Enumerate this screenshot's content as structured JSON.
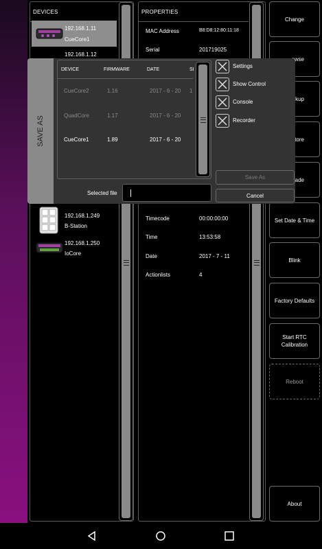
{
  "devices_panel": {
    "title": "DEVICES",
    "items": [
      {
        "ip": "192.168.1.11",
        "name": "CueCore1",
        "icon": "cuecore-icon",
        "selected": true
      },
      {
        "ip": "192.168.1.12",
        "name": "",
        "icon": "cuecore-icon",
        "selected": false
      },
      {
        "ip": "192.168.1.249",
        "name": "B-Station",
        "icon": "bstation-icon",
        "selected": false
      },
      {
        "ip": "192.168.1.250",
        "name": "IoCore",
        "icon": "iocore-icon",
        "selected": false
      }
    ]
  },
  "properties_panel": {
    "title": "PROPERTIES",
    "rows": [
      {
        "label": "MAC Address",
        "value": "B8:D8:12:80:11:18"
      },
      {
        "label": "Serial",
        "value": "201719025"
      },
      {
        "label": "Timecode",
        "value": "00:00:00:00"
      },
      {
        "label": "Time",
        "value": "13:53:58"
      },
      {
        "label": "Date",
        "value": "2017 - 7 - 11"
      },
      {
        "label": "Actionlists",
        "value": "4"
      }
    ]
  },
  "right_buttons": {
    "change": "Change",
    "browse": "owse",
    "backup": "ckup",
    "restore": "store",
    "upgrade": "rade",
    "set_date_time": "Set Date & Time",
    "blink": "Blink",
    "factory_defaults": "Factory Defaults",
    "start_rtc_calibration": "Start RTC Calibration",
    "reboot": "Reboot",
    "about": "About"
  },
  "save_as_dialog": {
    "tab_label": "SAVE AS",
    "columns": {
      "device": "DEVICE",
      "firmware": "FIRMWARE",
      "date": "DATE",
      "size": "SI"
    },
    "rows": [
      {
        "device": "CueCore2",
        "firmware": "1.16",
        "date": "2017 - 6 - 20",
        "size": "1",
        "dimmed": true
      },
      {
        "device": "QuadCore",
        "firmware": "1.17",
        "date": "2017 - 6 - 20",
        "size": "",
        "dimmed": true
      },
      {
        "device": "CueCore1",
        "firmware": "1.89",
        "date": "2017 - 6 - 20",
        "size": "",
        "dimmed": false
      }
    ],
    "checkboxes": [
      {
        "label": "Settings",
        "checked": true
      },
      {
        "label": "Show Control",
        "checked": true
      },
      {
        "label": "Console",
        "checked": true
      },
      {
        "label": "Recorder",
        "checked": true
      }
    ],
    "selected_file_label": "Selected file",
    "selected_file_value": "",
    "save_as_button": "Save As",
    "cancel_button": "Cancel"
  },
  "colors": {
    "accent_gradient": "#8a1080",
    "selected_row": "#8e8e8e",
    "dialog_bg": "#333333",
    "tab_bg": "#8a8a8a"
  }
}
